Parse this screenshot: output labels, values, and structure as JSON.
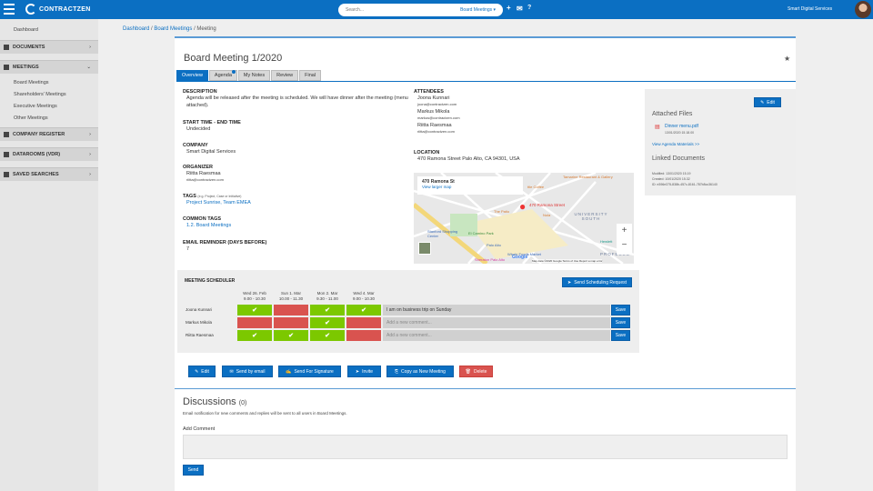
{
  "topbar": {
    "brand": "CONTRACTZEN",
    "search_placeholder": "Search...",
    "search_scope": "Board Meetings ▾",
    "org": "Smart Digital Services"
  },
  "sidebar": {
    "dashboard": "Dashboard",
    "documents": "DOCUMENTS",
    "meetings": "MEETINGS",
    "meeting_items": [
      "Board Meetings",
      "Shareholders' Meetings",
      "Executive Meetings",
      "Other Meetings"
    ],
    "company_register": "COMPANY REGISTER",
    "datarooms": "DATAROOMS (VDR)",
    "saved_searches": "SAVED SEARCHES"
  },
  "breadcrumb": {
    "items": [
      "Dashboard",
      "Board Meetings"
    ],
    "current": "Meeting",
    "sep": " / "
  },
  "meeting": {
    "title": "Board Meeting 1/2020",
    "tabs": [
      "Overview",
      "Agenda",
      "My Notes",
      "Review",
      "Final"
    ],
    "description_label": "DESCRIPTION",
    "description": "Agenda will be released after the meeting is scheduled. We will have dinner after the meeting (menu attached).",
    "time_label": "START TIME - END TIME",
    "time": "Undecided",
    "company_label": "COMPANY",
    "company": "Smart Digital Services",
    "organizer_label": "ORGANIZER",
    "organizer": "Riitta Raesmaa",
    "organizer_email": "riitta@contractzen.com",
    "tags_label": "TAGS",
    "tags_hint": "(e.g. Project, Case or Initiative)",
    "tags": "Project Sunrise, Team EMEA",
    "common_tags_label": "COMMON TAGS",
    "common_tags": "1.2. Board Meetings",
    "reminder_label": "EMAIL REMINDER (DAYS BEFORE)",
    "reminder": "7",
    "attendees_label": "ATTENDEES",
    "attendees": [
      {
        "name": "Joona Kunnari",
        "email": "joona@contractzen.com"
      },
      {
        "name": "Markus Mikola",
        "email": "markus@contractzen.com"
      },
      {
        "name": "Riitta Raesmaa",
        "email": "riitta@contractzen.com"
      }
    ],
    "location_label": "LOCATION",
    "location": "470 Ramona Street Palo Alto, CA 94301, USA"
  },
  "map": {
    "place": "470 Ramona St",
    "larger": "View larger map",
    "pin": "470 Ramona Street",
    "labels": [
      "Tamarine Restaurant & Gallery",
      "ttle Coffee",
      "The Patio",
      "Nola",
      "UNIVERSITY SOUTH",
      "El Camino Park",
      "Stanford Shopping Center",
      "Palo Alto",
      "Whole Foods Market",
      "Hewlett",
      "Sheraton Palo Alto",
      "PROFESSO"
    ],
    "footer": "Map data ©2020 Google   Terms of Use   Report a map error",
    "google": "Google"
  },
  "panel": {
    "edit": "Edit",
    "attached_title": "Attached Files",
    "file": "Dinner menu.pdf",
    "file_date": "13/01/2020 15.18.00",
    "agenda_link": "View Agenda Materials >>",
    "linked_title": "Linked Documents",
    "modified": "Modified: 13/01/2020 15.19",
    "created": "Created: 10/01/2020 15.32",
    "id": "ID: e396e375-838b-457c-8161-787b8cc36140"
  },
  "scheduler": {
    "title": "MEETING SCHEDULER",
    "send_request": "Send Scheduling Request",
    "dates": [
      {
        "day": "Wed 26. Feb",
        "time": "9.00 - 10.30"
      },
      {
        "day": "Sun 1. Mar",
        "time": "10.00 - 11.30"
      },
      {
        "day": "Mon 2. Mar",
        "time": "9.30 - 11.00"
      },
      {
        "day": "Wed 4. Mar",
        "time": "9.00 - 10.30"
      }
    ],
    "rows": [
      {
        "name": "Joona Kunnari",
        "votes": [
          true,
          false,
          true,
          true
        ],
        "comment": "I am on business trip on Sunday"
      },
      {
        "name": "Markus Mikola",
        "votes": [
          false,
          false,
          true,
          false
        ],
        "comment": ""
      },
      {
        "name": "Riitta Raesmaa",
        "votes": [
          true,
          true,
          true,
          false
        ],
        "comment": ""
      }
    ],
    "comment_placeholder": "Add a new comment...",
    "save": "Save"
  },
  "actions": {
    "edit": "Edit",
    "email": "Send by email",
    "signature": "Send For Signature",
    "invite": "Invite",
    "copy": "Copy as New Meeting",
    "delete": "Delete"
  },
  "discussions": {
    "title": "Discussions",
    "count": "(0)",
    "note": "Email notification for new comments and replies will be sent to all users in Board Meetings.",
    "add_label": "Add Comment",
    "send": "Send"
  },
  "colors": {
    "brand": "#0b6fc2",
    "yes": "#7cc800",
    "no": "#d9534f"
  }
}
